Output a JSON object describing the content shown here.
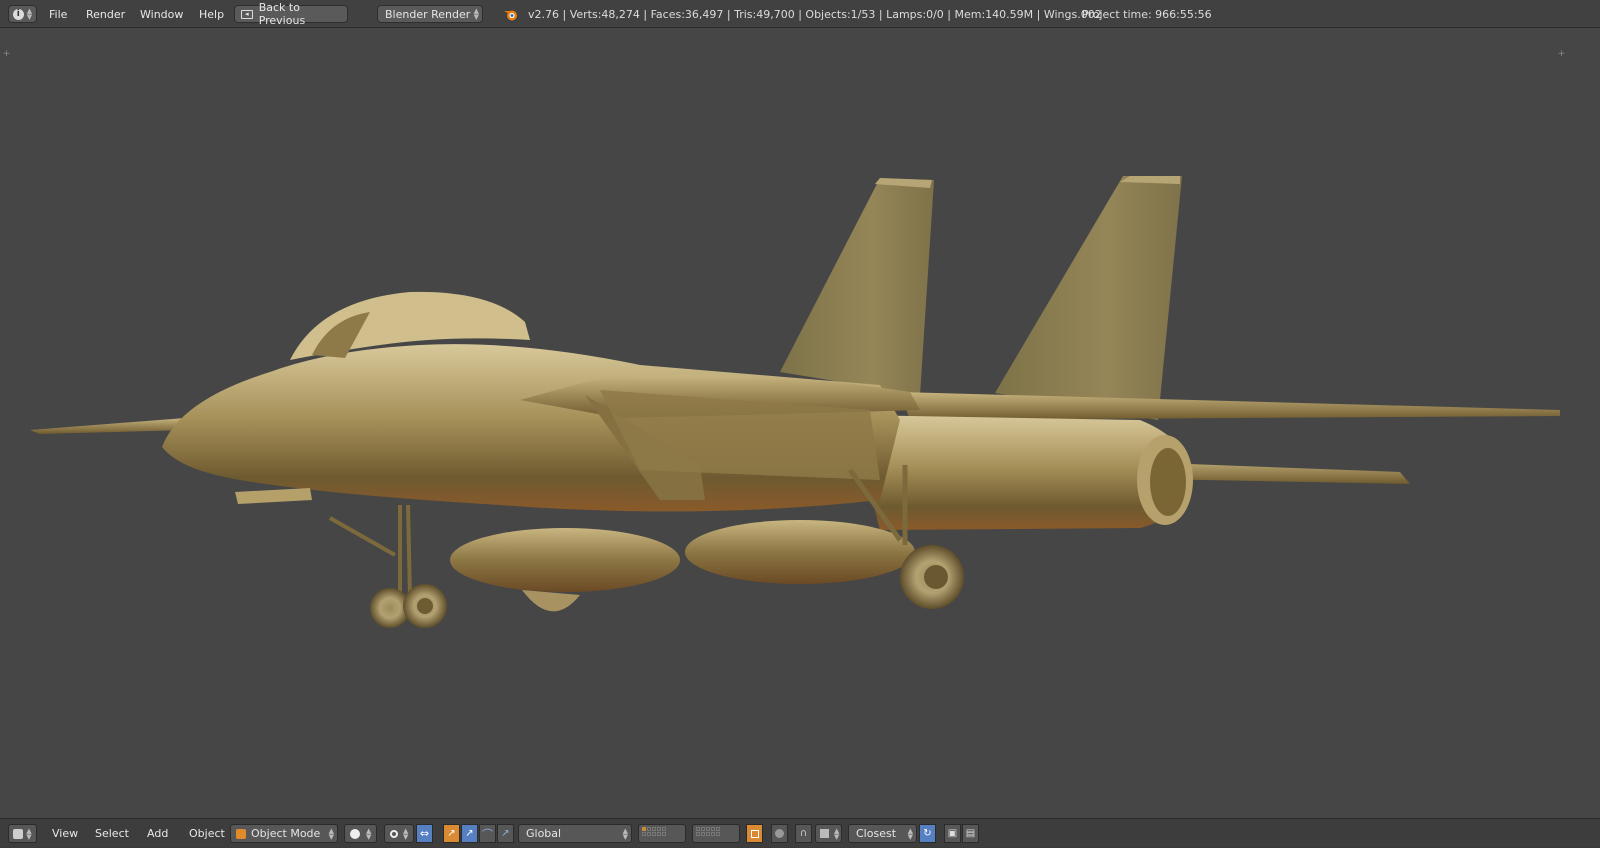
{
  "top_menu": {
    "items": [
      "File",
      "Render",
      "Window",
      "Help"
    ],
    "back_label": "Back to Previous",
    "render_engine": "Blender Render",
    "stats": "v2.76 | Verts:48,274 | Faces:36,497 | Tris:49,700 | Objects:1/53 | Lamps:0/0 | Mem:140.59M | Wings.002",
    "project_time": "Project time: 966:55:56"
  },
  "bottom_menu": {
    "items": [
      "View",
      "Select",
      "Add",
      "Object"
    ],
    "mode": "Object Mode",
    "orientation": "Global",
    "snap_target": "Closest"
  },
  "colors": {
    "viewport_bg": "#464646",
    "header_bg": "#414141",
    "accent_blue": "#5680c2",
    "accent_orange": "#d98a33",
    "model_gold": "#a08a55"
  },
  "icons": {
    "info": "info-icon",
    "blender": "blender-logo-icon",
    "editor_type": "3d-view-editor-icon",
    "mode": "object-mode-cube-icon",
    "shading": "solid-shading-icon",
    "pivot": "pivot-point-icon",
    "manipulator": "manipulator-icon",
    "snap": "magnet-snap-icon",
    "render": "camera-render-icon"
  }
}
